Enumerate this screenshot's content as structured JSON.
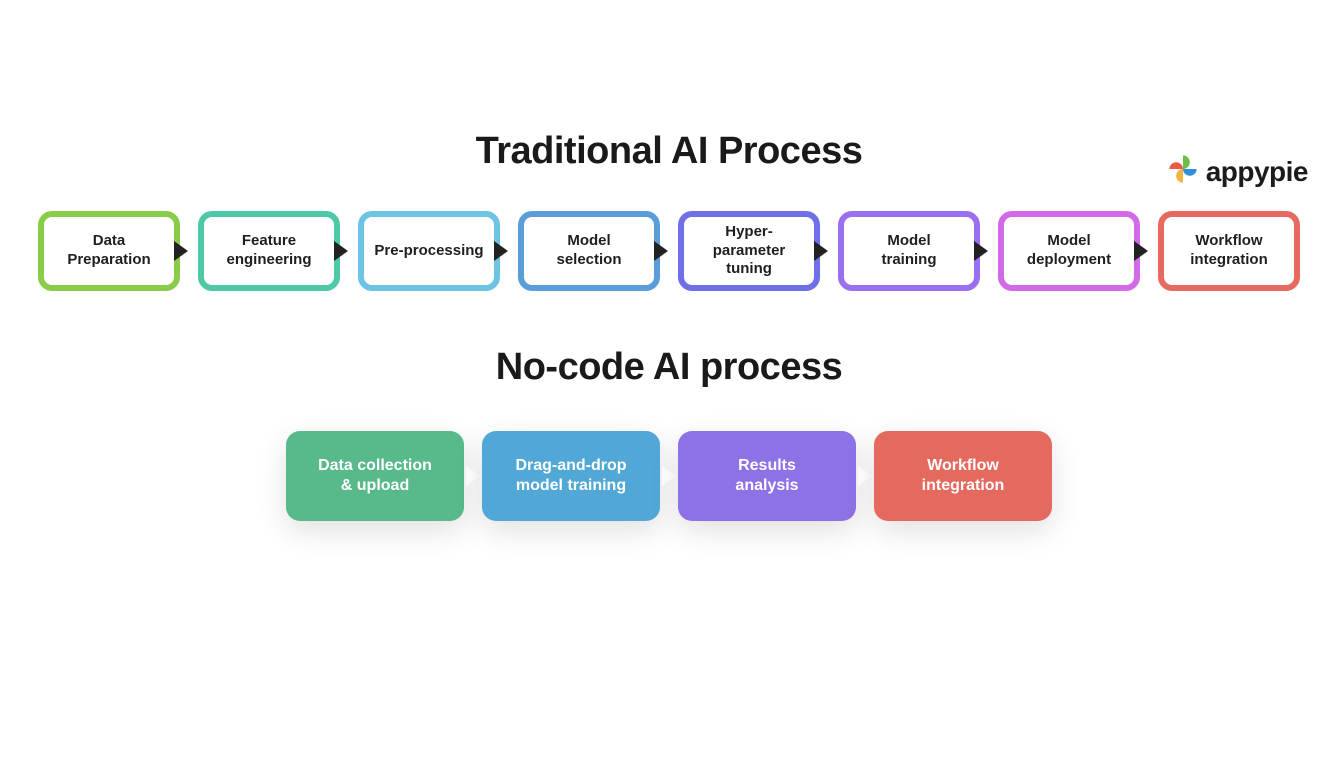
{
  "logo": {
    "text": "appypie"
  },
  "section1": {
    "title": "Traditional AI Process",
    "steps": [
      {
        "label": "Data\nPreparation",
        "color": "c-green"
      },
      {
        "label": "Feature\nengineering",
        "color": "c-teal"
      },
      {
        "label": "Pre-processing",
        "color": "c-sky"
      },
      {
        "label": "Model\nselection",
        "color": "c-blue"
      },
      {
        "label": "Hyper-\nparameter\ntuning",
        "color": "c-indigo"
      },
      {
        "label": "Model\ntraining",
        "color": "c-violet"
      },
      {
        "label": "Model\ndeployment",
        "color": "c-magenta"
      },
      {
        "label": "Workflow\nintegration",
        "color": "c-red"
      }
    ]
  },
  "section2": {
    "title": "No-code AI process",
    "steps": [
      {
        "label": "Data collection\n& upload",
        "color": "bg-green"
      },
      {
        "label": "Drag-and-drop\nmodel training",
        "color": "bg-blue"
      },
      {
        "label": "Results\nanalysis",
        "color": "bg-violet"
      },
      {
        "label": "Workflow\nintegration",
        "color": "bg-red"
      }
    ]
  }
}
